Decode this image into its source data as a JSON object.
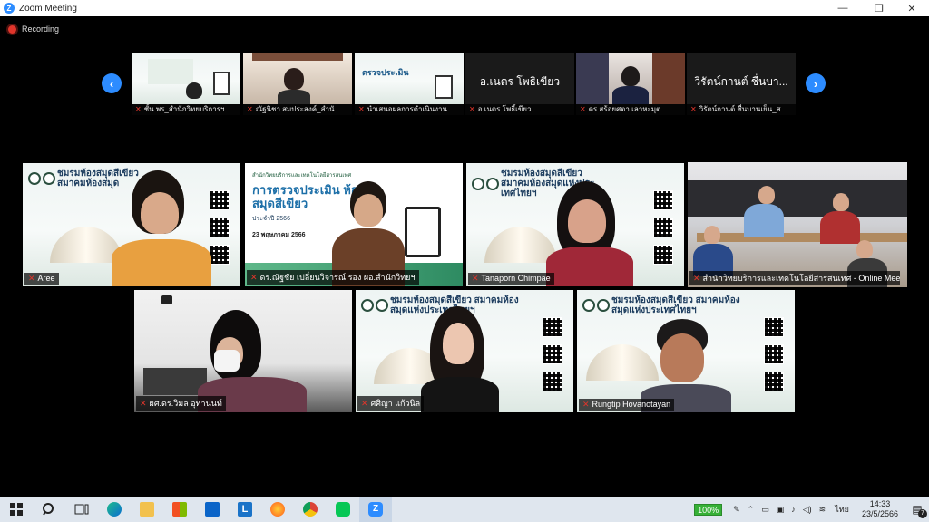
{
  "window": {
    "title": "Zoom Meeting",
    "minimize": "—",
    "maximize": "❐",
    "close": "✕"
  },
  "recording": {
    "label": "Recording"
  },
  "strip": {
    "prev": "‹",
    "next": "›",
    "thumbs": [
      {
        "name": "ชั้น.พร_สำนักวิทยบริการฯ",
        "kind": "slide"
      },
      {
        "name": "ณัฐนิชา สมประสงค์_สำนั...",
        "kind": "person"
      },
      {
        "name": "นำเสนอผลการดำเนินงาน...",
        "kind": "slide"
      },
      {
        "name": "อ.เนตร โพธิ์เขียว",
        "kind": "text",
        "big": "อ.เนตร โพธิเขียว"
      },
      {
        "name": "ดร.สร้อยศตา เลาหะมุต",
        "kind": "person"
      },
      {
        "name": "วิรัตน์กานต์ ชื่นบานเย็น_ส...",
        "kind": "text",
        "big": "วิรัตน์กานต์ ชื่นบา..."
      }
    ]
  },
  "tiles": [
    {
      "name": "Aree",
      "banner": "ชมรมห้องสมุดสีเขียว สมาคมห้องสมุด"
    },
    {
      "name": "ดร.ณัฐชัย เปลี่ยนวิจารณ์ รอง ผอ.สำนักวิทยฯ",
      "slide_title": "การตรวจประเมิน ห้องสมุดสีเขียว",
      "slide_sub": "ประจำปี 2566",
      "slide_date": "23 พฤษภาคม 2566",
      "slide_head": "สำนักวิทยบริการและเทคโนโลยีสารสนเทศ"
    },
    {
      "name": "Tanaporn Chimpae",
      "banner": "ชมรมห้องสมุดสีเขียว สมาคมห้องสมุดแห่งประเทศไทยฯ"
    },
    {
      "name": "สำนักวิทยบริการและเทคโนโลยีสารสนเทศ - Online Meeti..."
    },
    {
      "name": "ผศ.ดร.วิมล อุทานนท์"
    },
    {
      "name": "ศศิญา แก้วนิล",
      "banner": "ชมรมห้องสมุดสีเขียว สมาคมห้องสมุดแห่งประเทศไทยฯ"
    },
    {
      "name": "Rungtip Hovanotayan",
      "banner": "ชมรมห้องสมุดสีเขียว สมาคมห้องสมุดแห่งประเทศไทยฯ"
    }
  ],
  "taskbar": {
    "battery": "100%",
    "lang": "ไทย",
    "time": "14:33",
    "date": "23/5/2566",
    "notif": "7"
  }
}
